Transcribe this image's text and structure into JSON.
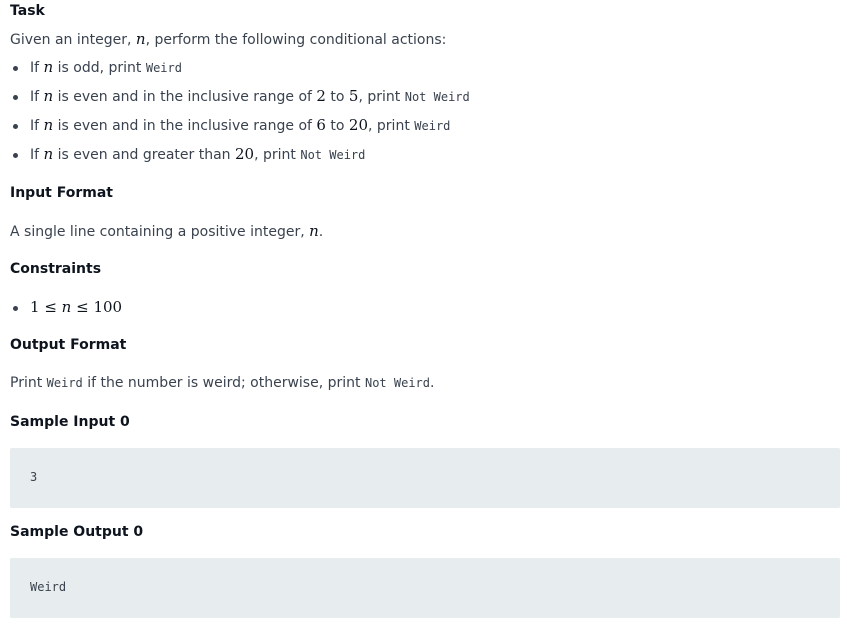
{
  "task": {
    "heading": "Task",
    "intro_pre": "Given an integer, ",
    "intro_var": "n",
    "intro_post": ", perform the following conditional actions:",
    "items": [
      {
        "pre": "If ",
        "var": "n",
        "mid": " is odd, print ",
        "code": "Weird"
      },
      {
        "pre": "If ",
        "var": "n",
        "mid": " is even and in the inclusive range of ",
        "num1": "2",
        "to": " to ",
        "num2": "5",
        "post": ", print ",
        "code": "Not Weird"
      },
      {
        "pre": "If ",
        "var": "n",
        "mid": " is even and in the inclusive range of ",
        "num1": "6",
        "to": " to ",
        "num2": "20",
        "post": ", print ",
        "code": "Weird"
      },
      {
        "pre": "If ",
        "var": "n",
        "mid": " is even and greater than ",
        "num1": "20",
        "post": ", print ",
        "code": "Not Weird"
      }
    ]
  },
  "input_format": {
    "heading": "Input Format",
    "text_pre": "A single line containing a positive integer, ",
    "text_var": "n",
    "text_post": "."
  },
  "constraints": {
    "heading": "Constraints",
    "item_low": "1",
    "item_op1": " ≤ ",
    "item_var": "n",
    "item_op2": " ≤ ",
    "item_high": "100"
  },
  "output_format": {
    "heading": "Output Format",
    "text_pre": "Print ",
    "code1": "Weird",
    "text_mid": " if the number is weird; otherwise, print ",
    "code2": "Not Weird",
    "text_post": "."
  },
  "sample_input": {
    "heading": "Sample Input 0",
    "value": "3"
  },
  "sample_output": {
    "heading": "Sample Output 0",
    "value": "Weird"
  }
}
